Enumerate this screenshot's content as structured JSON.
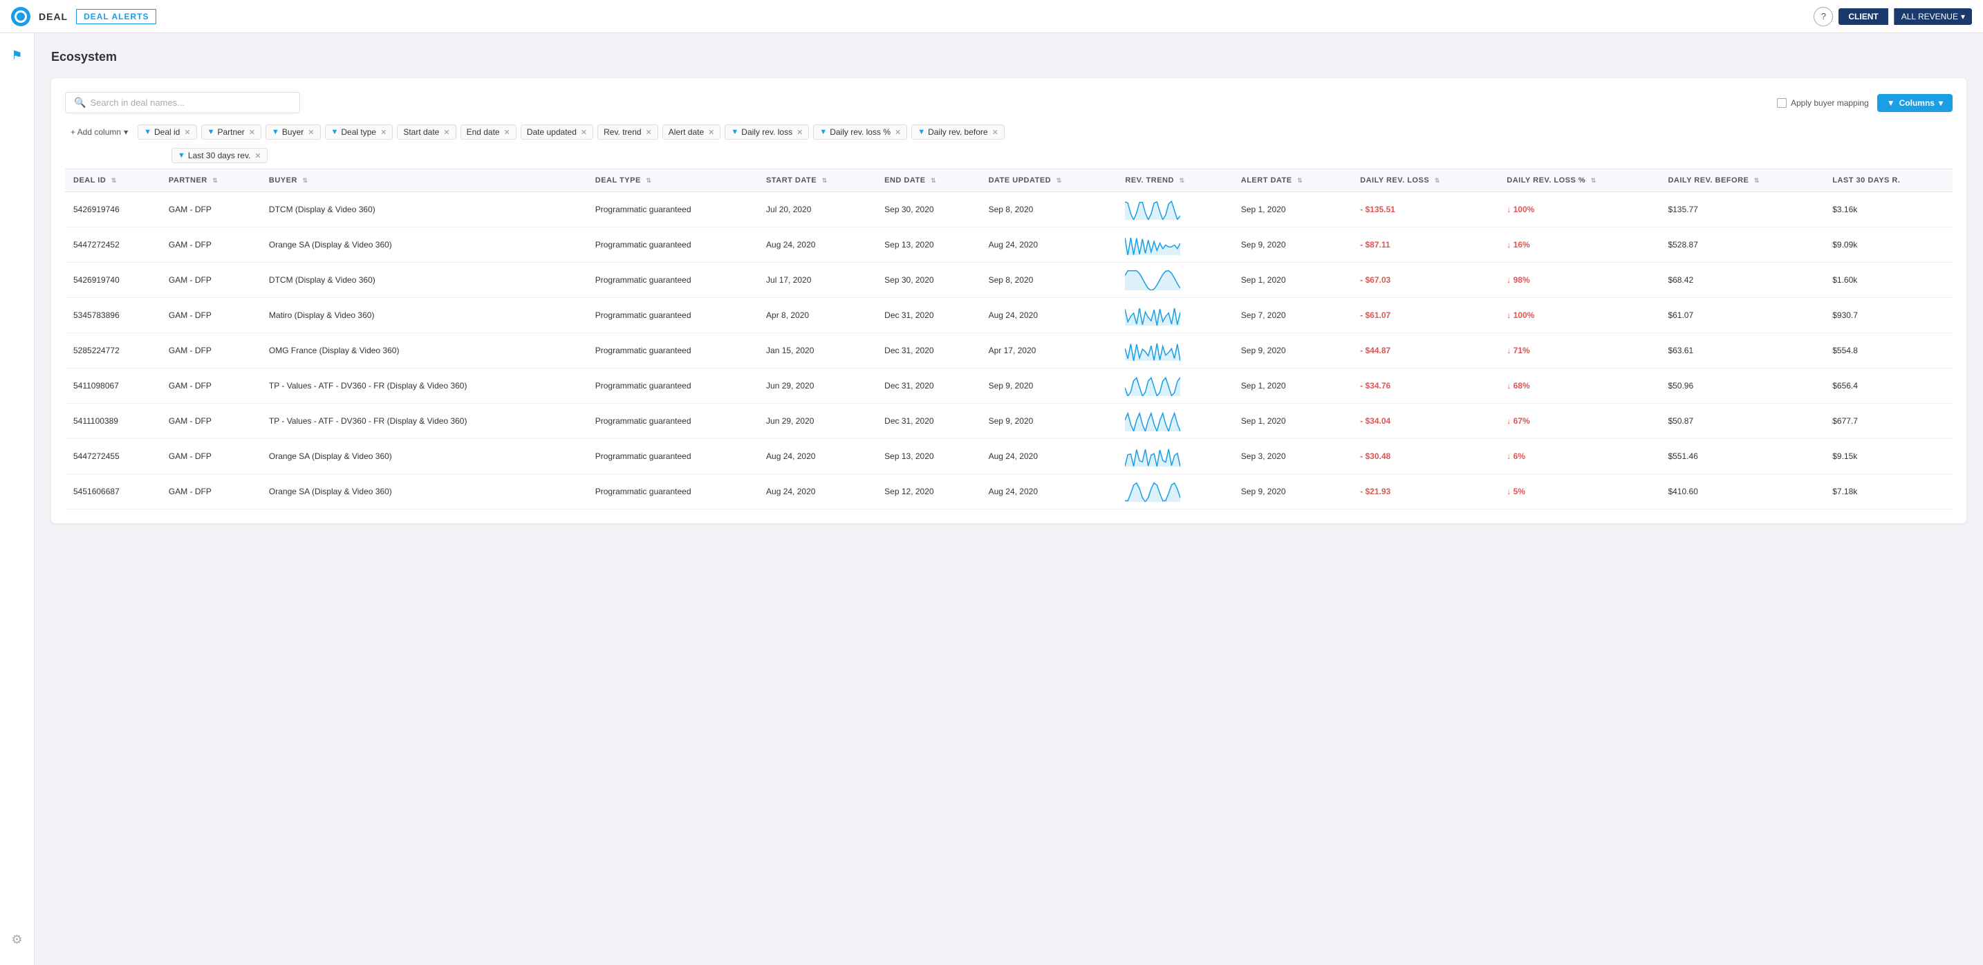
{
  "nav": {
    "deal_label": "DEAL",
    "alerts_label": "DEAL ALERTS",
    "help_label": "?",
    "client_label": "CLIENT",
    "revenue_label": "ALL REVENUE"
  },
  "page": {
    "title": "Ecosystem"
  },
  "search": {
    "placeholder": "Search in deal names..."
  },
  "controls": {
    "apply_mapping": "Apply buyer mapping",
    "columns_label": "Columns"
  },
  "filters": {
    "add_column": "+ Add column",
    "tags": [
      {
        "label": "Deal id",
        "has_icon": true
      },
      {
        "label": "Partner",
        "has_icon": true
      },
      {
        "label": "Buyer",
        "has_icon": true
      },
      {
        "label": "Deal type",
        "has_icon": true
      },
      {
        "label": "Start date",
        "has_icon": false
      },
      {
        "label": "End date",
        "has_icon": false
      },
      {
        "label": "Date updated",
        "has_icon": false
      },
      {
        "label": "Rev. trend",
        "has_icon": false
      },
      {
        "label": "Alert date",
        "has_icon": false
      },
      {
        "label": "Daily rev. loss",
        "has_icon": true
      },
      {
        "label": "Daily rev. loss %",
        "has_icon": true
      },
      {
        "label": "Daily rev. before",
        "has_icon": true
      }
    ],
    "second_row": [
      {
        "label": "Last 30 days rev.",
        "has_icon": true
      }
    ]
  },
  "table": {
    "headers": [
      {
        "label": "DEAL ID",
        "sortable": true
      },
      {
        "label": "PARTNER",
        "sortable": true
      },
      {
        "label": "BUYER",
        "sortable": true
      },
      {
        "label": "DEAL TYPE",
        "sortable": true
      },
      {
        "label": "START DATE",
        "sortable": true
      },
      {
        "label": "END DATE",
        "sortable": true
      },
      {
        "label": "DATE UPDATED",
        "sortable": true
      },
      {
        "label": "REV. TREND",
        "sortable": true
      },
      {
        "label": "ALERT DATE",
        "sortable": true
      },
      {
        "label": "DAILY REV. LOSS",
        "sortable": true
      },
      {
        "label": "DAILY REV. LOSS %",
        "sortable": true
      },
      {
        "label": "DAILY REV. BEFORE",
        "sortable": true
      },
      {
        "label": "LAST 30 DAYS R.",
        "sortable": false
      }
    ],
    "rows": [
      {
        "deal_id": "5426919746",
        "partner": "GAM - DFP",
        "buyer": "DTCM (Display & Video 360)",
        "deal_type": "Programmatic guaranteed",
        "start_date": "Jul 20, 2020",
        "end_date": "Sep 30, 2020",
        "date_updated": "Sep 8, 2020",
        "alert_date": "Sep 1, 2020",
        "daily_rev_loss": "- $135.51",
        "daily_rev_loss_pct": "↓ 100%",
        "daily_rev_before": "$135.77",
        "last_30": "$3.16k"
      },
      {
        "deal_id": "5447272452",
        "partner": "GAM - DFP",
        "buyer": "Orange SA (Display & Video 360)",
        "deal_type": "Programmatic guaranteed",
        "start_date": "Aug 24, 2020",
        "end_date": "Sep 13, 2020",
        "date_updated": "Aug 24, 2020",
        "alert_date": "Sep 9, 2020",
        "daily_rev_loss": "- $87.11",
        "daily_rev_loss_pct": "↓ 16%",
        "daily_rev_before": "$528.87",
        "last_30": "$9.09k"
      },
      {
        "deal_id": "5426919740",
        "partner": "GAM - DFP",
        "buyer": "DTCM (Display & Video 360)",
        "deal_type": "Programmatic guaranteed",
        "start_date": "Jul 17, 2020",
        "end_date": "Sep 30, 2020",
        "date_updated": "Sep 8, 2020",
        "alert_date": "Sep 1, 2020",
        "daily_rev_loss": "- $67.03",
        "daily_rev_loss_pct": "↓ 98%",
        "daily_rev_before": "$68.42",
        "last_30": "$1.60k"
      },
      {
        "deal_id": "5345783896",
        "partner": "GAM - DFP",
        "buyer": "Matiro (Display & Video 360)",
        "deal_type": "Programmatic guaranteed",
        "start_date": "Apr 8, 2020",
        "end_date": "Dec 31, 2020",
        "date_updated": "Aug 24, 2020",
        "alert_date": "Sep 7, 2020",
        "daily_rev_loss": "- $61.07",
        "daily_rev_loss_pct": "↓ 100%",
        "daily_rev_before": "$61.07",
        "last_30": "$930.7"
      },
      {
        "deal_id": "5285224772",
        "partner": "GAM - DFP",
        "buyer": "OMG France (Display & Video 360)",
        "deal_type": "Programmatic guaranteed",
        "start_date": "Jan 15, 2020",
        "end_date": "Dec 31, 2020",
        "date_updated": "Apr 17, 2020",
        "alert_date": "Sep 9, 2020",
        "daily_rev_loss": "- $44.87",
        "daily_rev_loss_pct": "↓ 71%",
        "daily_rev_before": "$63.61",
        "last_30": "$554.8"
      },
      {
        "deal_id": "5411098067",
        "partner": "GAM - DFP",
        "buyer": "TP - Values - ATF - DV360 - FR (Display & Video 360)",
        "deal_type": "Programmatic guaranteed",
        "start_date": "Jun 29, 2020",
        "end_date": "Dec 31, 2020",
        "date_updated": "Sep 9, 2020",
        "alert_date": "Sep 1, 2020",
        "daily_rev_loss": "- $34.76",
        "daily_rev_loss_pct": "↓ 68%",
        "daily_rev_before": "$50.96",
        "last_30": "$656.4"
      },
      {
        "deal_id": "5411100389",
        "partner": "GAM - DFP",
        "buyer": "TP - Values - ATF - DV360 - FR (Display & Video 360)",
        "deal_type": "Programmatic guaranteed",
        "start_date": "Jun 29, 2020",
        "end_date": "Dec 31, 2020",
        "date_updated": "Sep 9, 2020",
        "alert_date": "Sep 1, 2020",
        "daily_rev_loss": "- $34.04",
        "daily_rev_loss_pct": "↓ 67%",
        "daily_rev_before": "$50.87",
        "last_30": "$677.7"
      },
      {
        "deal_id": "5447272455",
        "partner": "GAM - DFP",
        "buyer": "Orange SA (Display & Video 360)",
        "deal_type": "Programmatic guaranteed",
        "start_date": "Aug 24, 2020",
        "end_date": "Sep 13, 2020",
        "date_updated": "Aug 24, 2020",
        "alert_date": "Sep 3, 2020",
        "daily_rev_loss": "- $30.48",
        "daily_rev_loss_pct": "↓ 6%",
        "daily_rev_before": "$551.46",
        "last_30": "$9.15k"
      },
      {
        "deal_id": "5451606687",
        "partner": "GAM - DFP",
        "buyer": "Orange SA (Display & Video 360)",
        "deal_type": "Programmatic guaranteed",
        "start_date": "Aug 24, 2020",
        "end_date": "Sep 12, 2020",
        "date_updated": "Aug 24, 2020",
        "alert_date": "Sep 9, 2020",
        "daily_rev_loss": "- $21.93",
        "daily_rev_loss_pct": "↓ 5%",
        "daily_rev_before": "$410.60",
        "last_30": "$7.18k"
      }
    ]
  }
}
